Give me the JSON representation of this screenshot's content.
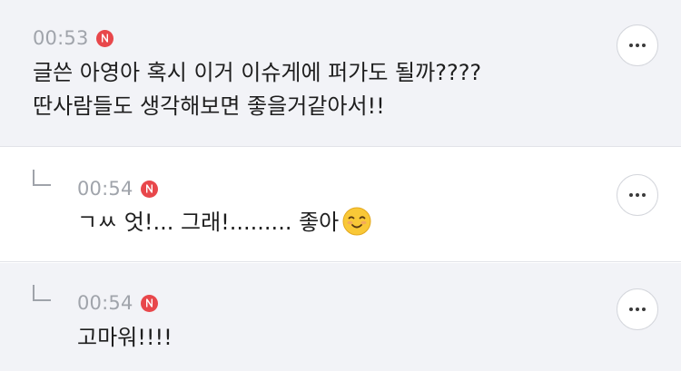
{
  "comments": [
    {
      "time": "00:53",
      "badge_letter": "N",
      "lines": [
        "글쓴 아영아 혹시 이거 이슈게에 퍼가도 될까????",
        "딴사람들도 생각해보면 좋을거같아서!!"
      ],
      "is_reply": false
    },
    {
      "time": "00:54",
      "badge_letter": "N",
      "text": "ㄱㅆ 엇!... 그래!......... 좋아",
      "emoji": "smiling-face-icon",
      "is_reply": true
    },
    {
      "time": "00:54",
      "badge_letter": "N",
      "text": "고마워!!!!",
      "is_reply": true
    }
  ],
  "colors": {
    "badge": "#e8474b",
    "highlight_bg": "#f2f3f7",
    "time": "#a0a4ab",
    "text": "#1e1e1e"
  }
}
